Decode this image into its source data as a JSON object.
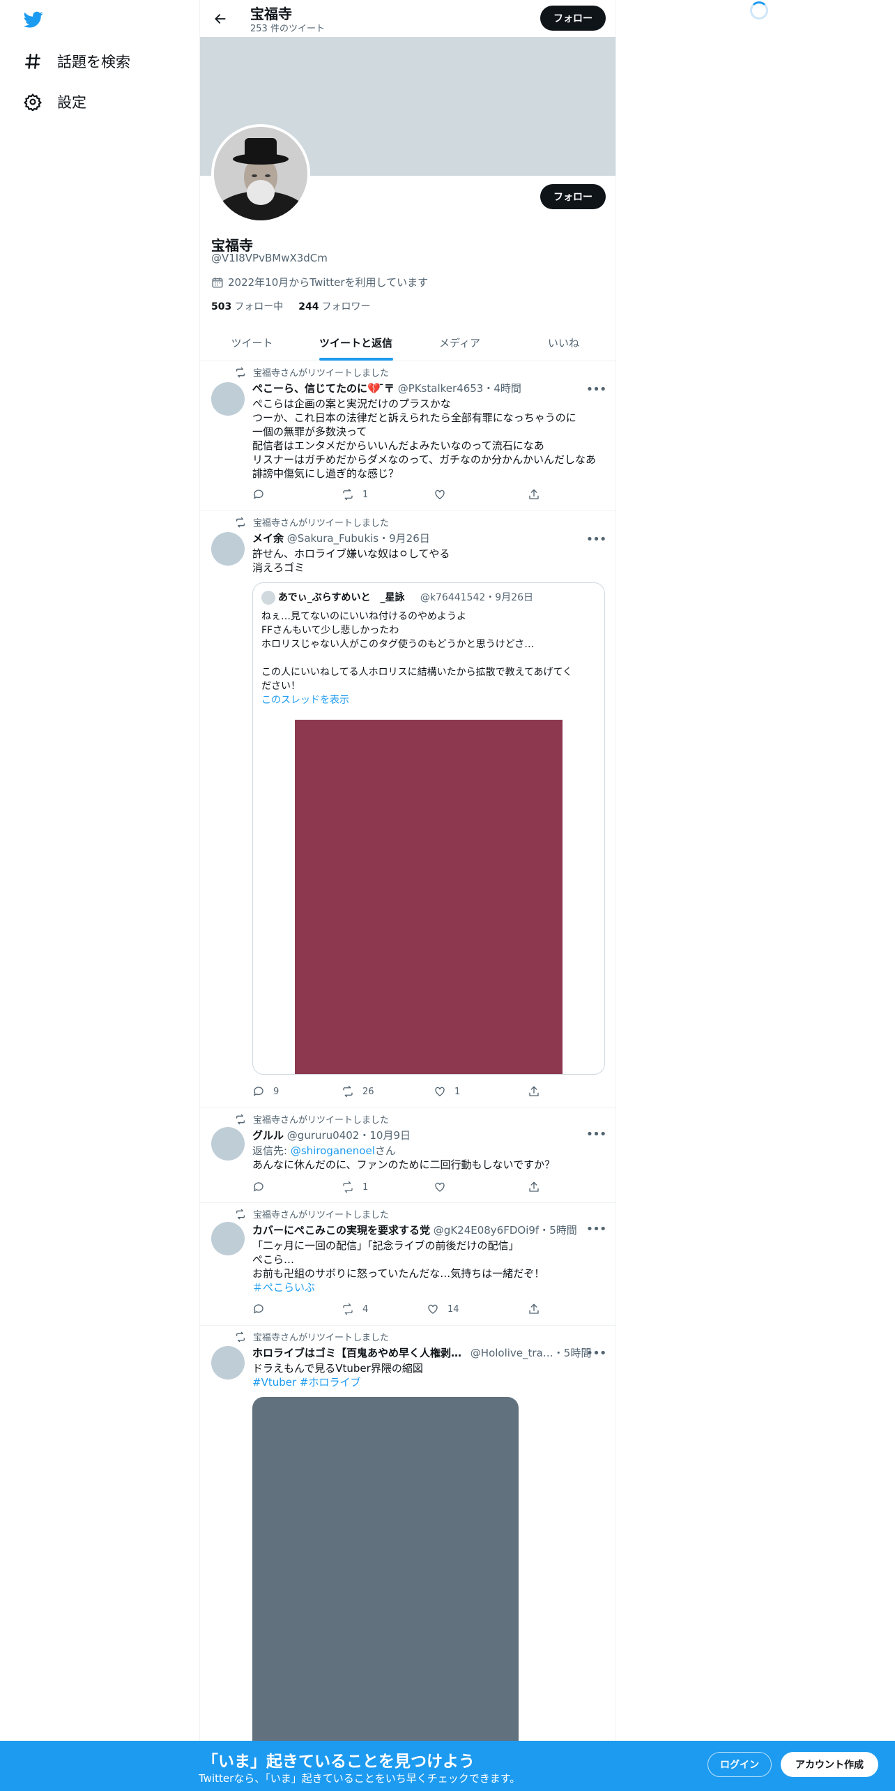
{
  "colors": {
    "accent": "#1d9bf0",
    "banner": "#cfd9de",
    "media1": "#8e3850",
    "media2": "#61717e",
    "avatar": "#bfcdd6"
  },
  "nav": {
    "explore": "話題を検索",
    "settings": "設定"
  },
  "header": {
    "name": "宝福寺",
    "tweet_count": "253 件のツイート",
    "follow": "フォロー"
  },
  "profile": {
    "follow": "フォロー",
    "name": "宝福寺",
    "handle": "@V1I8VPvBMwX3dCm",
    "joined": "2022年10月からTwitterを利用しています",
    "following_count": "503",
    "following_label": "フォロー中",
    "followers_count": "244",
    "followers_label": "フォロワー"
  },
  "tabs": [
    "ツイート",
    "ツイートと返信",
    "メディア",
    "いいね"
  ],
  "retweet_label": "宝福寺さんがリツイートしました",
  "tweets": [
    {
      "name": "ぺこーら、信じてたのに💔 ̄〒",
      "handle": "@PKstalker4653",
      "time": "・4時間",
      "lines": [
        "ぺこらは企画の案と実況だけのプラスかな",
        "つーか、これ日本の法律だと訴えられたら全部有罪になっちゃうのに",
        "一個の無罪が多数決って",
        "配信者はエンタメだからいいんだよみたいなのって流石になあ",
        "リスナーはガチめだからダメなのって、ガチなのか分かんかいんだしなあ",
        "誹謗中傷気にし過ぎ的な感じ？"
      ],
      "replies": "",
      "retweets": "1",
      "likes": ""
    },
    {
      "name": "メイ余",
      "handle": "@Sakura_Fubukis",
      "time": "・9月26日",
      "lines": [
        "許せん、ホロライブ嫌いな奴はㅇしてやる",
        "消えろゴミ"
      ],
      "quote": {
        "name": "あでぃ_ぶらすめいと　_星詠",
        "handle": "@k76441542",
        "time": "・9月26日",
        "lines": [
          "ねぇ…見てないのにいいね付けるのやめようよ",
          "FFさんもいて少し悲しかったわ",
          "ホロリスじゃない人がこのタグ使うのもどうかと思うけどさ…",
          "",
          "この人にいいねしてる人ホロリスに結構いたから拡散で教えてあげてく",
          "ださい！"
        ],
        "show_thread": "このスレッドを表示"
      },
      "replies": "9",
      "retweets": "26",
      "likes": "1"
    },
    {
      "name": "グルル",
      "handle": "@gururu0402",
      "time": "・10月9日",
      "reply_prefix": "返信先: ",
      "reply_to": "@shiroganenoel",
      "reply_suffix": "さん",
      "lines": [
        "あんなに休んだのに、ファンのために二回行動もしないですか？"
      ],
      "replies": "",
      "retweets": "1",
      "likes": ""
    },
    {
      "name": "カバーにぺこみこの実現を要求する党",
      "handle": "@gK24E08y6FDOi9f",
      "time": "・5時間",
      "lines": [
        "「二ヶ月に一回の配信」「記念ライブの前後だけの配信」",
        "ぺこら…",
        "お前も卍組のサボりに怒っていたんだな…気持ちは一緒だぞ！"
      ],
      "hashtag": "＃ぺこらいぶ",
      "replies": "",
      "retweets": "4",
      "likes": "14"
    },
    {
      "name": "ホロライブはゴミ【百鬼あやめ早く人権剥…",
      "handle": "@Hololive_tra…",
      "time": "・5時間",
      "lines": [
        "ドラえもんで見るVtuber界隈の縮図"
      ],
      "hashtags": "#Vtuber #ホロライブ"
    }
  ],
  "bottom_bar": {
    "title": "「いま」起きていることを見つけよう",
    "subtitle": "Twitterなら、「いま」起きていることをいち早くチェックできます。",
    "login": "ログイン",
    "signup": "アカウント作成"
  }
}
